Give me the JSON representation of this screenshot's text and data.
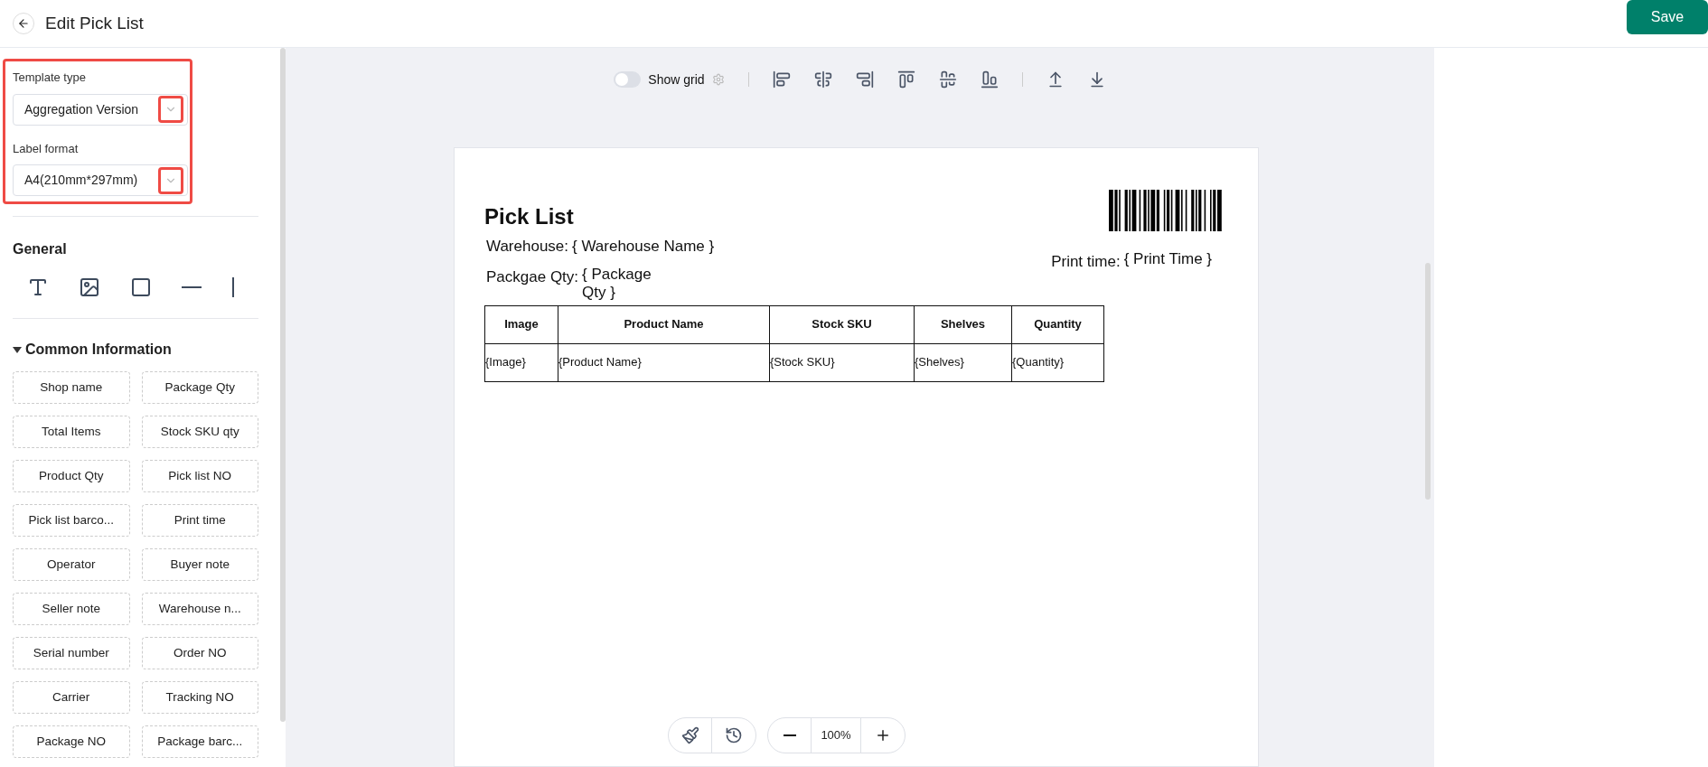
{
  "header": {
    "title": "Edit Pick List",
    "save_button": "Save"
  },
  "sidebar": {
    "template_type": {
      "label": "Template type",
      "value": "Aggregation Version"
    },
    "label_format": {
      "label": "Label format",
      "value": "A4(210mm*297mm)"
    },
    "general": {
      "title": "General"
    },
    "common_information": {
      "title": "Common Information",
      "expanded": true,
      "items": [
        "Shop name",
        "Package Qty",
        "Total Items",
        "Stock SKU qty",
        "Product Qty",
        "Pick list NO",
        "Pick list barco...",
        "Print time",
        "Operator",
        "Buyer note",
        "Seller note",
        "Warehouse n...",
        "Serial number",
        "Order NO",
        "Carrier",
        "Tracking NO",
        "Package NO",
        "Package barc..."
      ]
    }
  },
  "toolbar": {
    "show_grid": {
      "label": "Show grid",
      "on": false
    }
  },
  "document": {
    "title": "Pick List",
    "fields": [
      {
        "label": "Warehouse:",
        "value": "{ Warehouse Name }"
      },
      {
        "label": "Packgae Qty:",
        "value": "{ Package Qty }"
      }
    ],
    "print_time": {
      "label": "Print time:",
      "value": "{ Print Time }"
    },
    "table": {
      "columns": [
        "Image",
        "Product Name",
        "Stock SKU",
        "Shelves",
        "Quantity"
      ],
      "rows": [
        [
          "{Image}",
          "{Product Name}",
          "{Stock SKU}",
          "{Shelves}",
          "{Quantity}"
        ]
      ]
    }
  },
  "zoom_controls": {
    "level": "100%"
  }
}
